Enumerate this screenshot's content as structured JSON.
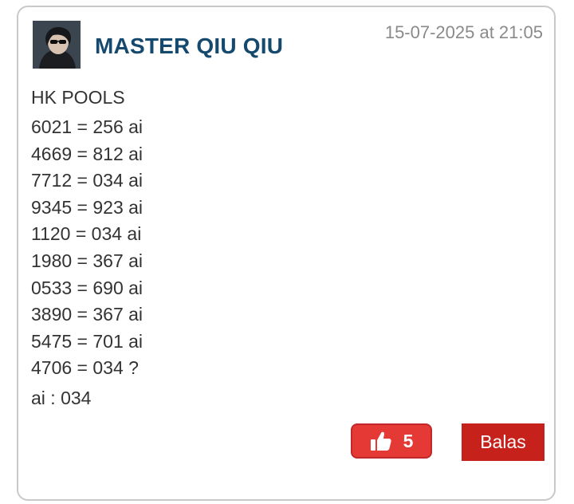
{
  "comment": {
    "author": "MASTER QIU QIU",
    "timestamp": "15-07-2025 at 21:05",
    "heading": "HK POOLS",
    "lines": [
      "6021 = 256 ai",
      "4669 = 812 ai",
      "7712 = 034 ai",
      "9345 = 923 ai",
      "1120 = 034 ai",
      "1980 = 367 ai",
      "0533 = 690 ai",
      "3890 = 367 ai",
      "5475 = 701 ai",
      "4706 = 034 ?"
    ],
    "footer": "ai : 034",
    "like_count": "5",
    "reply_label": "Balas"
  },
  "colors": {
    "author": "#16496e",
    "like_button": "#e53935",
    "reply_button": "#c7211b"
  },
  "icons": {
    "like": "thumbs-up-icon",
    "avatar": "user-avatar"
  }
}
